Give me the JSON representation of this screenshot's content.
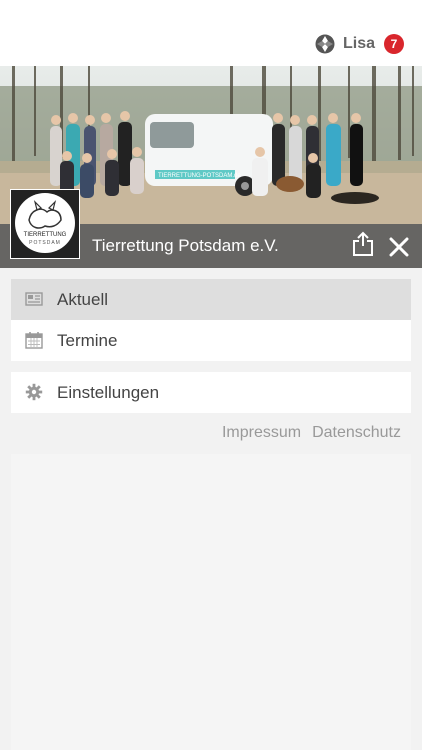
{
  "user": {
    "name": "Lisa",
    "notification_count": "7"
  },
  "organization": {
    "name": "Tierrettung Potsdam e.V.",
    "logo_text_line1": "TIERRETTUNG",
    "logo_text_line2": "POTSDAM"
  },
  "hero": {
    "van_text": "TIERRETTUNG-POTSDAM.de"
  },
  "menu": {
    "primary": [
      {
        "label": "Aktuell",
        "icon": "newspaper-icon",
        "active": true
      },
      {
        "label": "Termine",
        "icon": "calendar-icon",
        "active": false
      }
    ],
    "secondary": [
      {
        "label": "Einstellungen",
        "icon": "gear-icon",
        "active": false
      }
    ]
  },
  "footer": {
    "impressum": "Impressum",
    "datenschutz": "Datenschutz"
  },
  "colors": {
    "badge": "#d9262c",
    "header_bar": "#5f5f5f",
    "active_item": "#dedede"
  }
}
